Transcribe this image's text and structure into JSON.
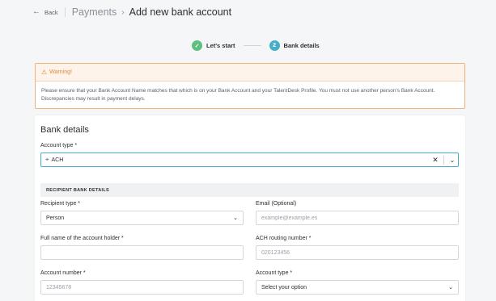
{
  "header": {
    "back_label": "Back",
    "breadcrumb_parent": "Payments",
    "page_title": "Add new bank account"
  },
  "stepper": {
    "steps": [
      {
        "label": "Let's start",
        "status": "done",
        "marker": "✓"
      },
      {
        "label": "Bank details",
        "status": "active",
        "marker": "2"
      }
    ]
  },
  "warning": {
    "title": "Warning!",
    "message": "Please ensure that your Bank Account Name matches that which is on your Bank Account and your TalentDesk Profile. You must not use another person's Bank Account. Discrepancies may result in payment delays."
  },
  "form": {
    "title": "Bank details",
    "account_type_label": "Account type *",
    "account_type_value": "ACH",
    "section_header": "RECIPIENT BANK DETAILS",
    "recipient_type_label": "Recipient type *",
    "recipient_type_value": "Person",
    "email_label": "Email (Optional)",
    "email_placeholder": "example@example.es",
    "holder_label": "Full name of the account holder *",
    "holder_value": "",
    "routing_label": "ACH routing number *",
    "routing_placeholder": "020123456",
    "account_number_label": "Account number *",
    "account_number_placeholder": "12345678",
    "account_type2_label": "Account type *",
    "account_type2_value": "Select your option"
  },
  "colors": {
    "accent": "#46aec9",
    "success": "#5fbf7f",
    "warning": "#e08a3a",
    "background": "#f5f6f7"
  },
  "icons": {
    "back": "arrow-left-icon",
    "chevron": "chevron-right-icon",
    "check": "check-icon",
    "warning": "warning-triangle-icon",
    "location": "location-pin-icon",
    "clear": "close-icon",
    "dropdown": "chevron-down-icon"
  }
}
